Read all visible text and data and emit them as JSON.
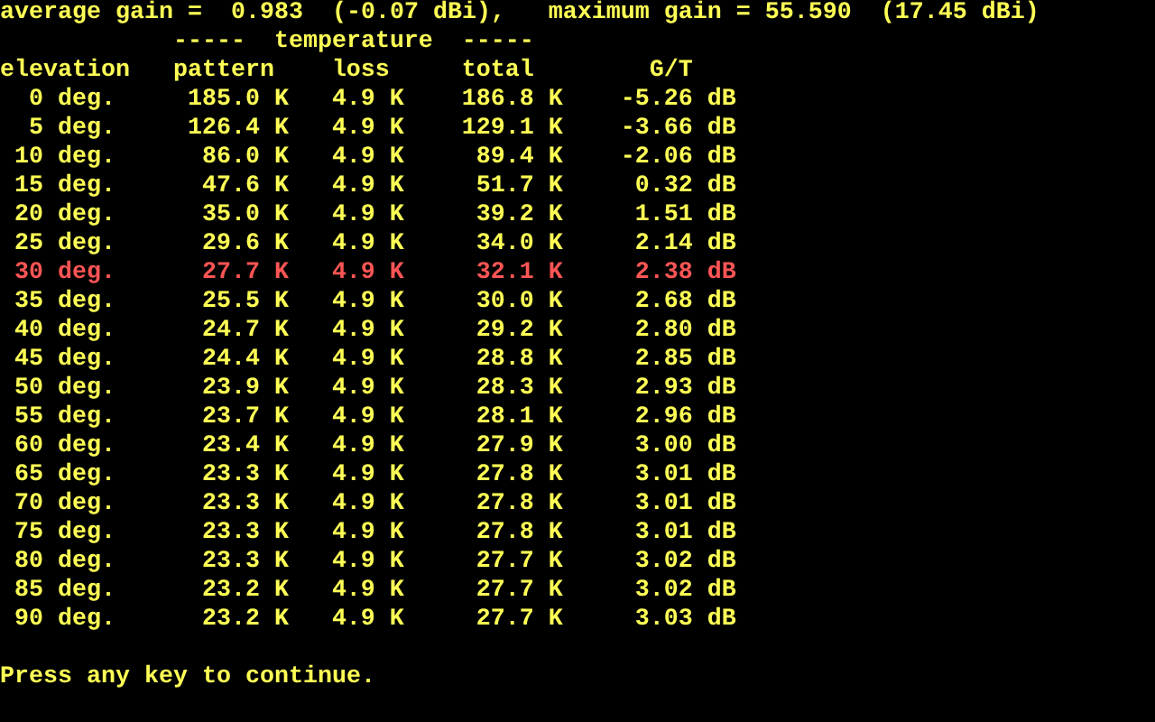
{
  "summary": {
    "average": "average gain =  0.983  (-0.07 dBi),",
    "maximum": "maximum gain = 55.590  (17.45 dBi)"
  },
  "group_header": {
    "left_rule": "-----",
    "label": "temperature",
    "right_rule": "-----"
  },
  "table": {
    "columns": [
      "elevation",
      "pattern",
      "loss",
      "total",
      "G/T"
    ],
    "rows": [
      {
        "cells": [
          "0 deg.",
          "185.0 K",
          "4.9 K",
          "186.8 K",
          "-5.26 dB"
        ],
        "highlighted": false
      },
      {
        "cells": [
          "5 deg.",
          "126.4 K",
          "4.9 K",
          "129.1 K",
          "-3.66 dB"
        ],
        "highlighted": false
      },
      {
        "cells": [
          "10 deg.",
          "86.0 K",
          "4.9 K",
          "89.4 K",
          "-2.06 dB"
        ],
        "highlighted": false
      },
      {
        "cells": [
          "15 deg.",
          "47.6 K",
          "4.9 K",
          "51.7 K",
          "0.32 dB"
        ],
        "highlighted": false
      },
      {
        "cells": [
          "20 deg.",
          "35.0 K",
          "4.9 K",
          "39.2 K",
          "1.51 dB"
        ],
        "highlighted": false
      },
      {
        "cells": [
          "25 deg.",
          "29.6 K",
          "4.9 K",
          "34.0 K",
          "2.14 dB"
        ],
        "highlighted": false
      },
      {
        "cells": [
          "30 deg.",
          "27.7 K",
          "4.9 K",
          "32.1 K",
          "2.38 dB"
        ],
        "highlighted": true
      },
      {
        "cells": [
          "35 deg.",
          "25.5 K",
          "4.9 K",
          "30.0 K",
          "2.68 dB"
        ],
        "highlighted": false
      },
      {
        "cells": [
          "40 deg.",
          "24.7 K",
          "4.9 K",
          "29.2 K",
          "2.80 dB"
        ],
        "highlighted": false
      },
      {
        "cells": [
          "45 deg.",
          "24.4 K",
          "4.9 K",
          "28.8 K",
          "2.85 dB"
        ],
        "highlighted": false
      },
      {
        "cells": [
          "50 deg.",
          "23.9 K",
          "4.9 K",
          "28.3 K",
          "2.93 dB"
        ],
        "highlighted": false
      },
      {
        "cells": [
          "55 deg.",
          "23.7 K",
          "4.9 K",
          "28.1 K",
          "2.96 dB"
        ],
        "highlighted": false
      },
      {
        "cells": [
          "60 deg.",
          "23.4 K",
          "4.9 K",
          "27.9 K",
          "3.00 dB"
        ],
        "highlighted": false
      },
      {
        "cells": [
          "65 deg.",
          "23.3 K",
          "4.9 K",
          "27.8 K",
          "3.01 dB"
        ],
        "highlighted": false
      },
      {
        "cells": [
          "70 deg.",
          "23.3 K",
          "4.9 K",
          "27.8 K",
          "3.01 dB"
        ],
        "highlighted": false
      },
      {
        "cells": [
          "75 deg.",
          "23.3 K",
          "4.9 K",
          "27.8 K",
          "3.01 dB"
        ],
        "highlighted": false
      },
      {
        "cells": [
          "80 deg.",
          "23.3 K",
          "4.9 K",
          "27.7 K",
          "3.02 dB"
        ],
        "highlighted": false
      },
      {
        "cells": [
          "85 deg.",
          "23.2 K",
          "4.9 K",
          "27.7 K",
          "3.02 dB"
        ],
        "highlighted": false
      },
      {
        "cells": [
          "90 deg.",
          "23.2 K",
          "4.9 K",
          "27.7 K",
          "3.03 dB"
        ],
        "highlighted": false
      }
    ]
  },
  "prompt": "Press any key to continue."
}
